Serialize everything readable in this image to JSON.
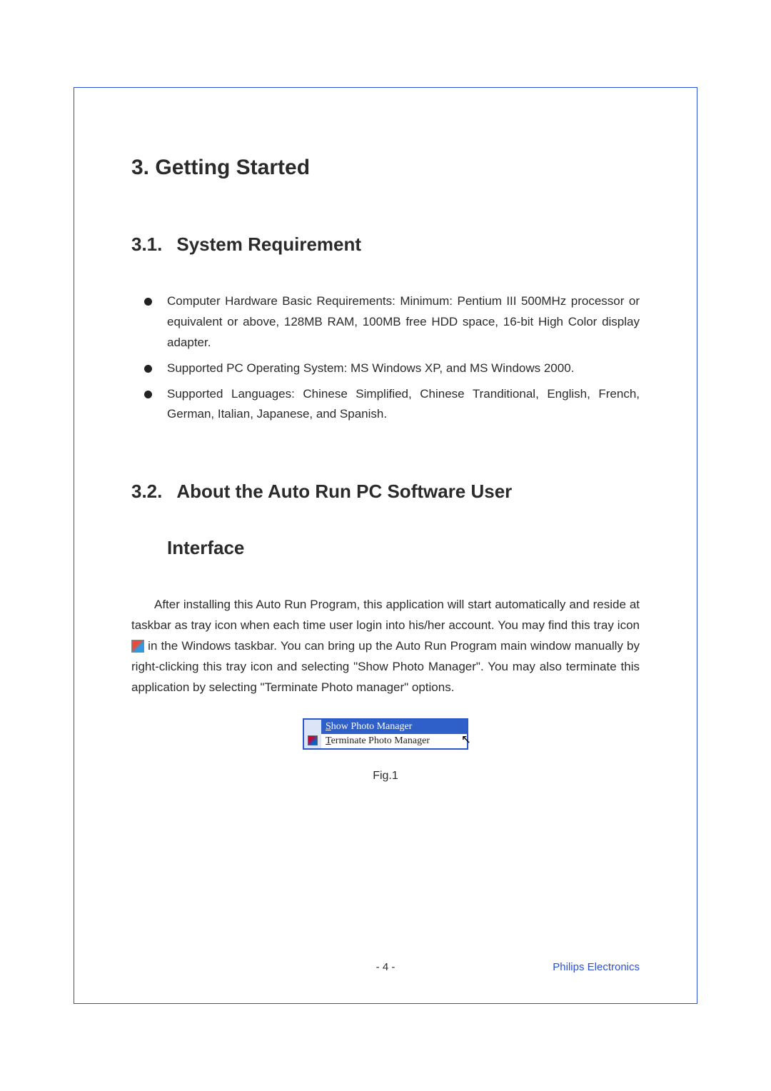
{
  "chapter": {
    "title": "3. Getting Started"
  },
  "section_3_1": {
    "number": "3.1.",
    "title": "System Requirement",
    "bullets": [
      "Computer Hardware Basic Requirements: Minimum: Pentium III 500MHz processor or equivalent or above, 128MB RAM, 100MB free HDD space, 16-bit High Color display adapter.",
      "Supported PC Operating System: MS Windows XP, and MS Windows 2000.",
      "Supported Languages: Chinese Simplified, Chinese Tranditional, English, French, German, Italian, Japanese, and Spanish."
    ]
  },
  "section_3_2": {
    "number": "3.2.",
    "title_line1": "About the Auto Run PC Software User",
    "title_line2": "Interface",
    "para_before": "After installing this Auto Run Program, this application will start automatically and reside at taskbar as tray icon when each time user login into his/her account. You may find this tray icon ",
    "para_after": " in the Windows taskbar. You can bring up the Auto Run Program main window manually by right-clicking this tray icon and selecting \"Show Photo Manager\". You may also terminate this application by selecting \"Terminate Photo manager\" options."
  },
  "context_menu": {
    "item1_prefix": "S",
    "item1_rest": "how Photo Manager",
    "item2_prefix": "T",
    "item2_rest": "erminate Photo Manager"
  },
  "figure": {
    "caption": "Fig.1"
  },
  "footer": {
    "page_number": "- 4 -",
    "brand": "Philips Electronics"
  }
}
